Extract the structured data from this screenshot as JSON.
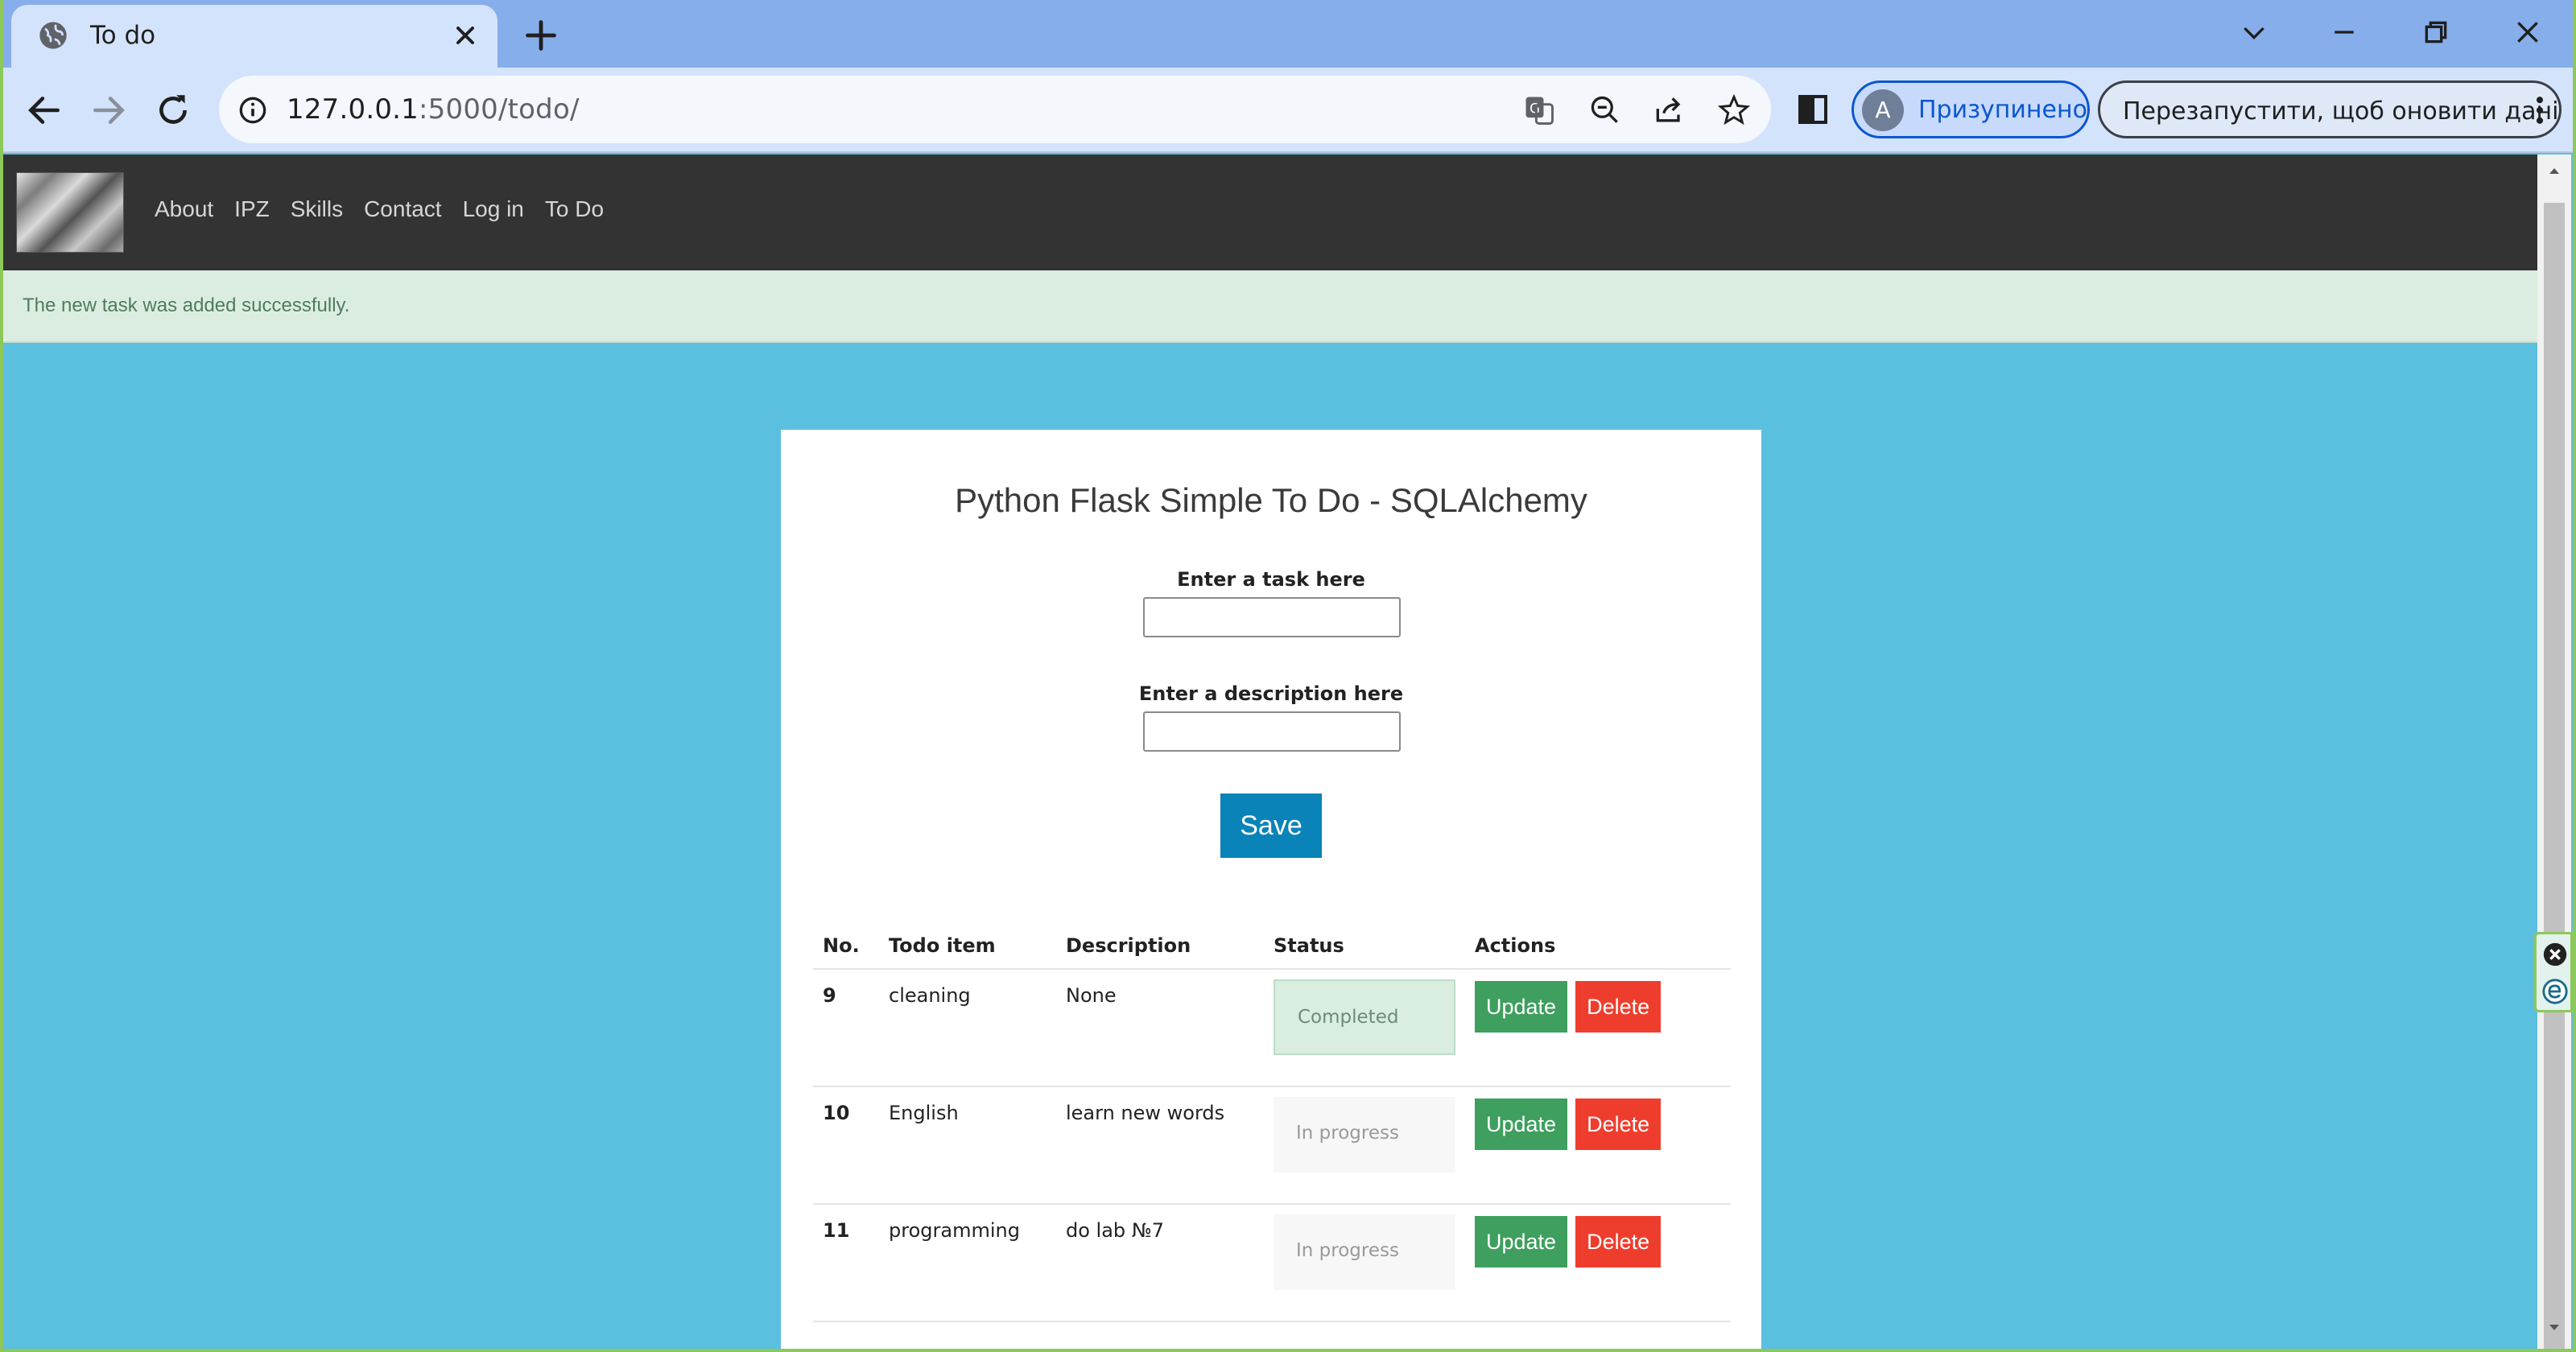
{
  "browser": {
    "tab_title": "To do",
    "url_host": "127.0.0.1",
    "url_rest": ":5000/todo/",
    "profile_initial": "A",
    "profile_label": "Призупинено",
    "restart_label": "Перезапустити, щоб оновити дані"
  },
  "site": {
    "nav": [
      "About",
      "IPZ",
      "Skills",
      "Contact",
      "Log in",
      "To Do"
    ],
    "flash_message": "The new task was added successfully."
  },
  "todo": {
    "title": "Python Flask Simple To Do - SQLAlchemy",
    "task_label": "Enter a task here",
    "desc_label": "Enter a description here",
    "task_value": "",
    "desc_value": "",
    "save_label": "Save",
    "headers": [
      "No.",
      "Todo item",
      "Description",
      "Status",
      "Actions"
    ],
    "rows": [
      {
        "no": "9",
        "item": "cleaning",
        "desc": "None",
        "status": "Completed",
        "update": "Update",
        "delete": "Delete"
      },
      {
        "no": "10",
        "item": "English",
        "desc": "learn new words",
        "status": "In progress",
        "update": "Update",
        "delete": "Delete"
      },
      {
        "no": "11",
        "item": "programming",
        "desc": "do lab №7",
        "status": "In progress",
        "update": "Update",
        "delete": "Delete"
      }
    ]
  },
  "colors": {
    "page_bg": "#5bbfdf",
    "nav_bg": "#333333",
    "flash_bg": "#dbede0",
    "save_btn": "#0a83b8",
    "update_btn": "#3e9f5e",
    "delete_btn": "#ef3d2d"
  },
  "icons": [
    "globe-icon",
    "close-icon",
    "plus-icon",
    "chevron-down-icon",
    "minimize-icon",
    "restore-icon",
    "back-icon",
    "forward-icon",
    "reload-icon",
    "info-icon",
    "translate-icon",
    "zoom-out-icon",
    "share-icon",
    "star-icon",
    "side-panel-icon",
    "kebab-menu-icon"
  ]
}
